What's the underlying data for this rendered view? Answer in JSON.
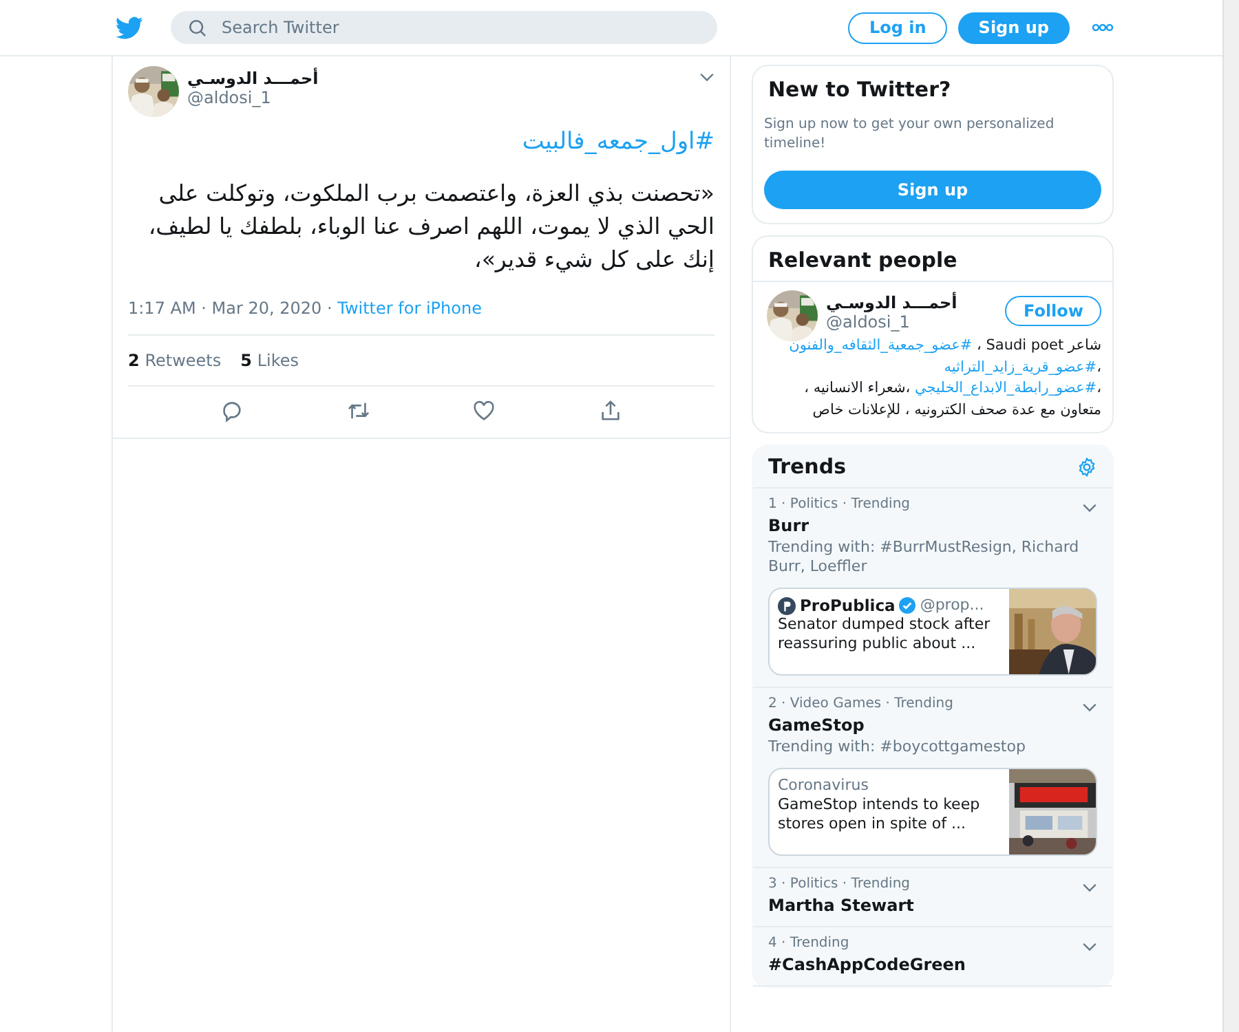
{
  "header": {
    "search": {
      "placeholder": "Search Twitter"
    },
    "buttons": [
      {
        "kind": "outline",
        "label": "Log in"
      },
      {
        "kind": "filled",
        "label": "Sign up"
      }
    ]
  },
  "tweet": {
    "author": {
      "name": "أحمـــد الدوسـي",
      "handle": "@aldosi_1"
    },
    "hashtag": "#اول_جمعه_فالبيت",
    "text": "«تحصنت بذي العزة، واعتصمت برب الملكوت، وتوكلت على الحي الذي لا يموت، اللهم اصرف عنا الوباء، بلطفك يا لطيف، إنك على كل شيء قدير»،",
    "timestamp": "1:17 AM · Mar 20, 2020 · ",
    "source": "Twitter for iPhone",
    "stats": [
      {
        "count": "2",
        "label": "Retweets"
      },
      {
        "count": "5",
        "label": "Likes"
      }
    ]
  },
  "signup_card": {
    "title": "New to Twitter?",
    "text": "Sign up now to get your own personalized timeline!",
    "button": "Sign up"
  },
  "relevant_people": {
    "title": "Relevant people",
    "person": {
      "name": "أحمـــد الدوسـي",
      "handle": "@aldosi_1",
      "button": "Follow",
      "bio": [
        {
          "kind": "text",
          "text": "شاعر Saudi poet ، "
        },
        {
          "kind": "link",
          "text": "#عضو_جمعية_الثقافه_والفنون"
        },
        {
          "kind": "text",
          "text": " ،"
        },
        {
          "kind": "link",
          "text": "#عضو_قرية_زايد_التراثيه"
        },
        {
          "kind": "text",
          "text": " ،"
        },
        {
          "kind": "link",
          "text": "#عضو_رابطة_الابداع_الخليجي"
        },
        {
          "kind": "text",
          "text": " ،شعراء الانسانيه ، متعاون مع عدة صحف الكترونيه ، للإعلانات خاص"
        }
      ]
    }
  },
  "trends": {
    "title": "Trends",
    "items": [
      {
        "meta": "1 · Politics · Trending",
        "title": "Burr",
        "subtitle": "Trending with: #BurrMustResign, Richard Burr, Loeffler",
        "card": {
          "kind": "account",
          "name": "ProPublica",
          "verified": true,
          "handle": "@prop...",
          "headline": "Senator dumped stock after reassuring public about ..."
        }
      },
      {
        "meta": "2 · Video Games · Trending",
        "title": "GameStop",
        "subtitle": "Trending with: #boycottgamestop",
        "card": {
          "kind": "topic",
          "label": "Coronavirus",
          "headline": "GameStop intends to keep stores open in spite of ..."
        }
      },
      {
        "meta": "3 · Politics · Trending",
        "title": "Martha Stewart"
      },
      {
        "meta": "4 · Trending",
        "title": "#CashAppCodeGreen"
      }
    ]
  }
}
